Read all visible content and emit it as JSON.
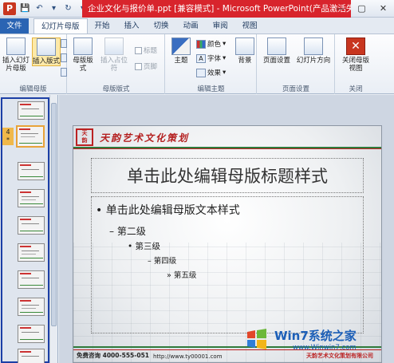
{
  "window": {
    "title": "企业文化与报价单.ppt [兼容模式] - Microsoft PowerPoint(产品激活失败)",
    "app_icon": "P",
    "controls": [
      "—",
      "▢",
      "✕"
    ]
  },
  "tabs": [
    {
      "label": "文件"
    },
    {
      "label": "幻灯片母版"
    },
    {
      "label": "开始"
    },
    {
      "label": "插入"
    },
    {
      "label": "切换"
    },
    {
      "label": "动画"
    },
    {
      "label": "审阅"
    },
    {
      "label": "视图"
    }
  ],
  "ribbon": {
    "groups": {
      "edit_master": "编辑母版",
      "master_layout": "母版版式",
      "edit_theme": "编辑主题",
      "page_setup": "页面设置",
      "close": "关闭"
    },
    "insert_master": "插入幻灯片母版",
    "insert_layout": "插入版式",
    "master_layout_btn": "母版版式",
    "insert_placeholder": "插入占位符",
    "title_chk": "标题",
    "footer_chk": "页脚",
    "theme": "主题",
    "colors": "颜色",
    "fonts": "字体",
    "effects": "效果",
    "background": "背景",
    "page_setup_btn": "页面设置",
    "orientation": "幻灯片方向",
    "close_master": "关闭母版视图"
  },
  "thumbnails": {
    "selected_number": "4",
    "selected_mark": "*"
  },
  "slide": {
    "logo_text": "天韵艺术文化策划",
    "title": "单击此处编辑母版标题样式",
    "level1": "单击此处编辑母版文本样式",
    "level2": "第二级",
    "level3": "第三级",
    "level4": "第四级",
    "level5": "第五级",
    "footer_left": "免费咨询 4000-555-051",
    "footer_url": "http://www.ty00001.com",
    "footer_right": "天韵艺术文化策划有限公司"
  },
  "watermark": {
    "title": "Win7系统之家",
    "url": "www.Winwin7.com"
  }
}
